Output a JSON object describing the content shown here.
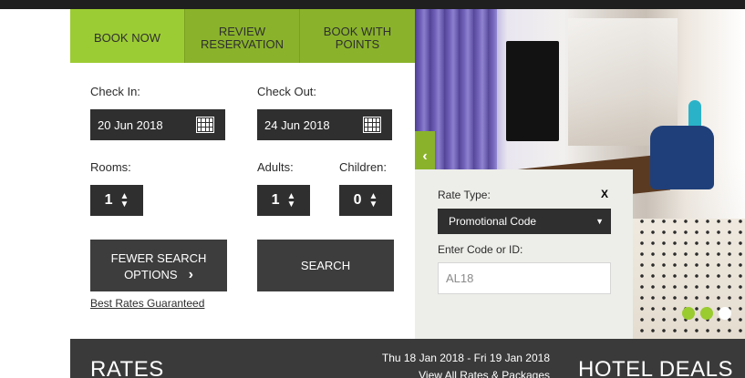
{
  "tabs": [
    {
      "label_line1": "BOOK NOW",
      "label_line2": ""
    },
    {
      "label_line1": "REVIEW",
      "label_line2": "RESERVATION"
    },
    {
      "label_line1": "BOOK WITH",
      "label_line2": "POINTS"
    }
  ],
  "booking": {
    "check_in_label": "Check In:",
    "check_in_value": "20 Jun 2018",
    "check_out_label": "Check Out:",
    "check_out_value": "24 Jun 2018",
    "rooms_label": "Rooms:",
    "rooms_value": "1",
    "adults_label": "Adults:",
    "adults_value": "1",
    "children_label": "Children:",
    "children_value": "0",
    "fewer_line1": "FEWER SEARCH",
    "fewer_line2": "OPTIONS",
    "search_label": "SEARCH",
    "best_rates_link": "Best Rates Guaranteed"
  },
  "rate_panel": {
    "title": "Rate Type:",
    "close": "X",
    "selected": "Promotional Code",
    "code_label": "Enter Code or ID:",
    "code_value": "AL18"
  },
  "carousel": {
    "dots_count": 3,
    "active_index": 2
  },
  "bottom": {
    "rates_title": "RATES",
    "date_range": "Thu 18 Jan 2018 - Fri 19 Jan 2018",
    "view_all": "View All Rates & Packages",
    "deals_title": "HOTEL DEALS"
  },
  "colors": {
    "accent_green": "#9ccc33",
    "tab_green": "#8ab32b",
    "dark_field": "#2f2f2f",
    "panel_bg": "#edeee9",
    "band": "#3a3a3a"
  }
}
